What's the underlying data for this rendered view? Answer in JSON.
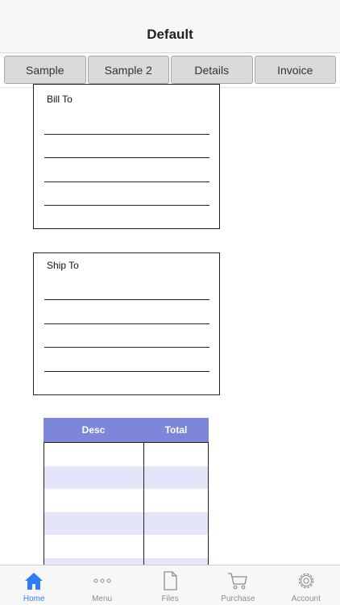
{
  "navbar": {
    "title": "Default"
  },
  "tabs": [
    {
      "label": "Sample"
    },
    {
      "label": "Sample 2"
    },
    {
      "label": "Details"
    },
    {
      "label": "Invoice"
    }
  ],
  "bill_to": {
    "label": "Bill To"
  },
  "ship_to": {
    "label": "Ship To"
  },
  "items_table": {
    "headers": {
      "desc": "Desc",
      "total": "Total"
    },
    "header_color": "#7e86d9",
    "alt_row_color": "#e4e5f8"
  },
  "tabbar": {
    "active_color": "#2f7cf6",
    "items": [
      {
        "label": "Home",
        "icon": "home-icon",
        "active": true
      },
      {
        "label": "Menu",
        "icon": "more-dots-icon",
        "active": false
      },
      {
        "label": "Files",
        "icon": "file-icon",
        "active": false
      },
      {
        "label": "Purchase",
        "icon": "cart-icon",
        "active": false
      },
      {
        "label": "Account",
        "icon": "gear-icon",
        "active": false
      }
    ]
  }
}
